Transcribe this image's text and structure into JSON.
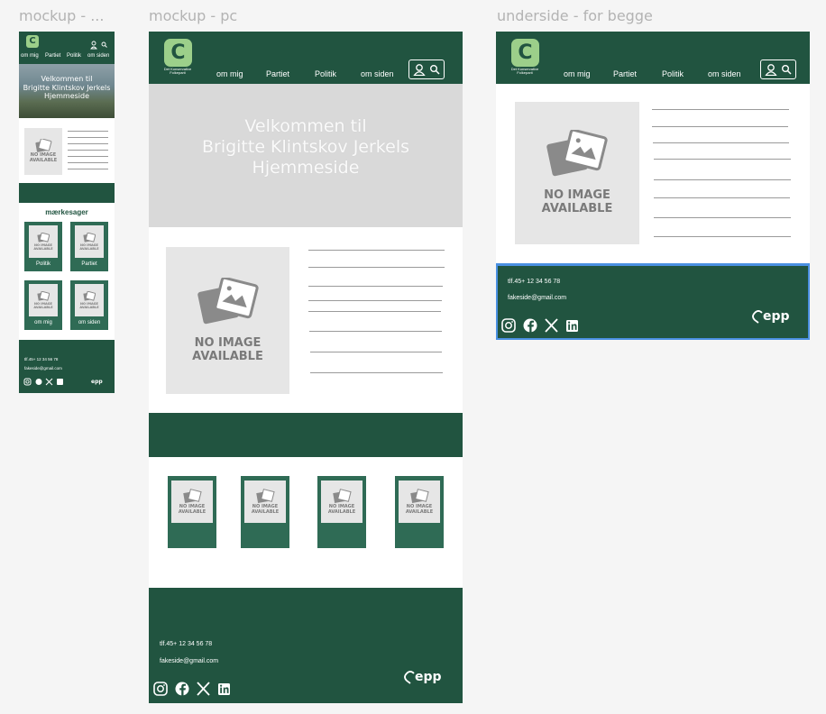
{
  "frames": {
    "mobile_label": "mockup - ...",
    "pc_label": "mockup - pc",
    "sub_label": "underside - for begge"
  },
  "logo": {
    "letter": "C",
    "subtitle_1": "Det Konservative",
    "subtitle_2": "Folkeparti"
  },
  "nav": {
    "items": [
      "om mig",
      "Partiet",
      "Politik",
      "om siden"
    ],
    "icons": [
      "user-icon",
      "search-icon"
    ]
  },
  "hero": {
    "line1": "Velkommen til",
    "line2": "Brigitte Klintskov Jerkels",
    "line3": "Hjemmeside"
  },
  "placeholder": {
    "line1": "NO IMAGE",
    "line2": "AVAILABLE"
  },
  "mobile": {
    "section_title": "mærkesager",
    "cards": [
      "Politik",
      "Partiet",
      "om mig",
      "om siden"
    ]
  },
  "footer": {
    "phone": "tlf.45+ 12 34 56 78",
    "email": "fakeside@gmail.com",
    "social": [
      "instagram-icon",
      "facebook-icon",
      "x-icon",
      "linkedin-icon"
    ],
    "brand": "epp"
  },
  "colors": {
    "primary": "#215440",
    "card": "#2f6b55",
    "logo_accent": "#9ccf8a",
    "selection": "#4a90e2"
  }
}
